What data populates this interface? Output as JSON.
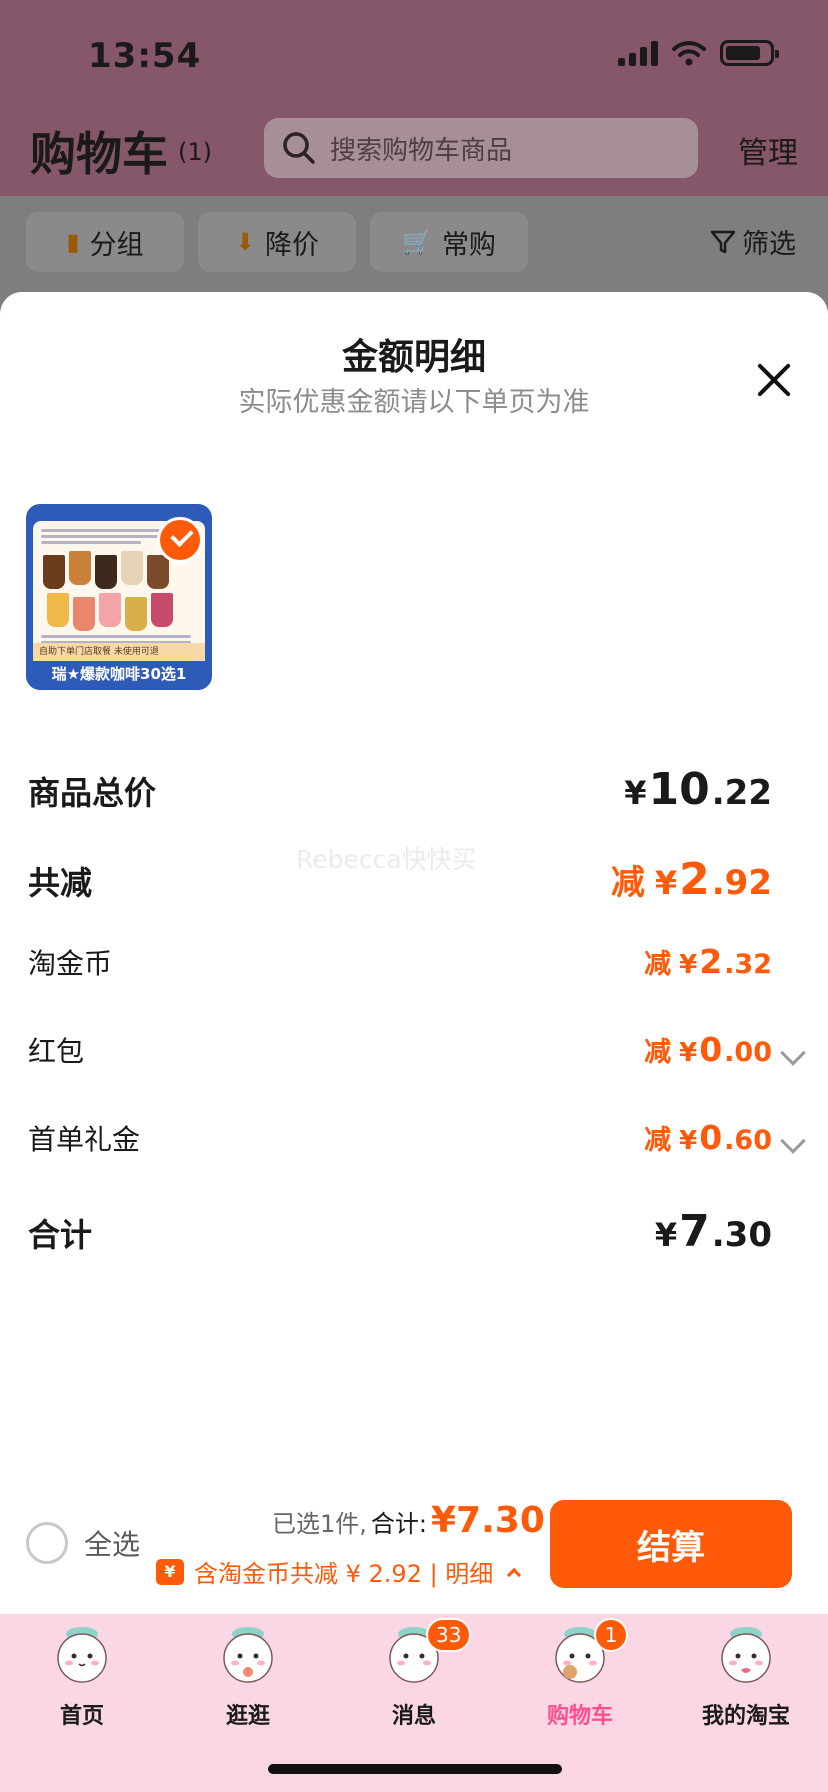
{
  "status_bar": {
    "time": "13:54"
  },
  "header": {
    "title": "购物车",
    "count": "(1)",
    "search_placeholder": "搜索购物车商品",
    "manage": "管理"
  },
  "filters": {
    "chips": [
      "分组",
      "降价",
      "常购"
    ],
    "filter_label": "筛选"
  },
  "sheet": {
    "title": "金额明细",
    "subtitle": "实际优惠金额请以下单页为准",
    "product": {
      "caption": "瑞★爆款咖啡30选1",
      "strip_text": "自助下单门店取餐  未使用可退",
      "selected": true
    },
    "watermark": "Rebecca快快买",
    "rows": {
      "goods_total": {
        "label": "商品总价",
        "currency": "¥",
        "int": "10",
        "dec": ".22"
      },
      "total_discount": {
        "label": "共减",
        "prefix": "减",
        "currency": "¥",
        "int": "2",
        "dec": ".92"
      },
      "taojinbi": {
        "label": "淘金币",
        "prefix": "减",
        "currency": "¥",
        "int": "2",
        "dec": ".32"
      },
      "red_packet": {
        "label": "红包",
        "prefix": "减",
        "currency": "¥",
        "int": "0",
        "dec": ".00"
      },
      "first_order_gift": {
        "label": "首单礼金",
        "prefix": "减",
        "currency": "¥",
        "int": "0",
        "dec": ".60"
      },
      "sum": {
        "label": "合计",
        "currency": "¥",
        "int": "7",
        "dec": ".30"
      }
    }
  },
  "checkout": {
    "select_all": "全选",
    "selected_text": "已选1件,",
    "total_label": "合计:",
    "total_value": "¥7.30",
    "coin_tag": "¥",
    "discount_detail": "含淘金币共减 ¥ 2.92 | 明细",
    "button": "结算"
  },
  "tabbar": {
    "tabs": [
      {
        "label": "首页"
      },
      {
        "label": "逛逛"
      },
      {
        "label": "消息",
        "badge": "33"
      },
      {
        "label": "购物车",
        "badge": "1",
        "active": true
      },
      {
        "label": "我的淘宝"
      }
    ]
  },
  "colors": {
    "accent": "#ff5a0a",
    "tab_active": "#ff4f8e",
    "tabbar_bg": "#fbd7e6"
  }
}
